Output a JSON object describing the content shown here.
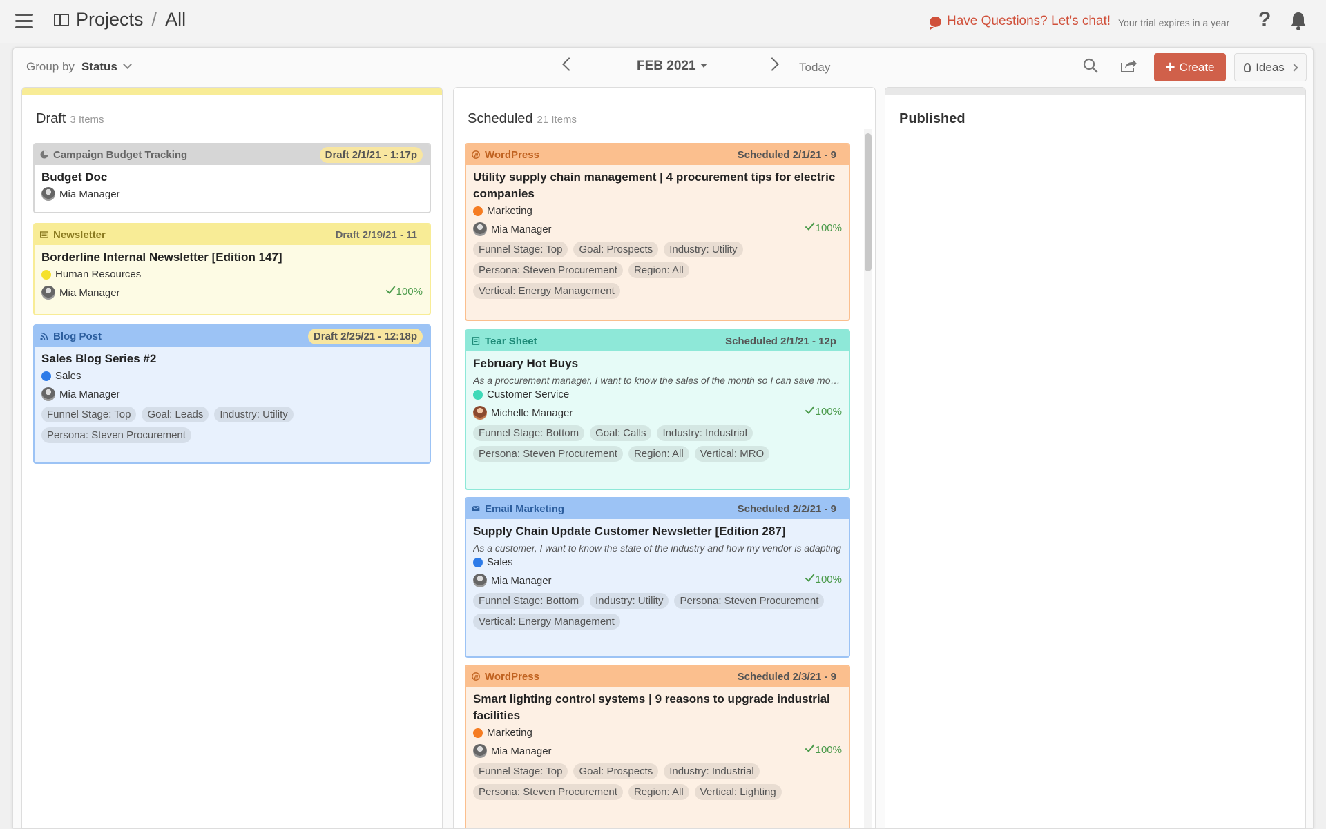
{
  "topbar": {
    "breadcrumb_root": "Projects",
    "breadcrumb_sep": "/",
    "breadcrumb_current": "All",
    "chat_label": "Have Questions? Let's chat!",
    "trial_text": "Your trial expires in a year",
    "help_label": "?"
  },
  "toolbar": {
    "group_by_label": "Group by",
    "group_by_value": "Status",
    "month": "FEB 2021",
    "today_label": "Today",
    "create_label": "Create",
    "ideas_label": "Ideas"
  },
  "columns": {
    "draft": {
      "title": "Draft",
      "count": "3 Items",
      "color": "#f8ec96"
    },
    "scheduled": {
      "title": "Scheduled",
      "count": "21 Items",
      "color": "#ffffff"
    },
    "published": {
      "title": "Published",
      "color": "#e8e8e8"
    }
  },
  "draft_cards": [
    {
      "type": "Campaign Budget Tracking",
      "date": "Draft 2/1/21 - 1:17p",
      "title": "Budget Doc",
      "owner": "Mia Manager"
    },
    {
      "type": "Newsletter",
      "date": "Draft 2/19/21 - 11",
      "title": "Borderline Internal Newsletter [Edition 147]",
      "dept": "Human Resources",
      "dept_color": "#f5e12a",
      "owner": "Mia Manager",
      "pct": "100%"
    },
    {
      "type": "Blog Post",
      "date": "Draft 2/25/21 - 12:18p",
      "title": "Sales Blog Series #2",
      "dept": "Sales",
      "dept_color": "#2d7be8",
      "owner": "Mia Manager",
      "tags": [
        "Funnel Stage: Top",
        "Goal: Leads",
        "Industry: Utility",
        "Persona: Steven Procurement"
      ]
    }
  ],
  "scheduled_cards": [
    {
      "type": "WordPress",
      "date": "Scheduled 2/1/21 - 9",
      "title": "Utility supply chain management | 4 procurement tips for electric companies",
      "dept": "Marketing",
      "dept_color": "#f57c22",
      "owner": "Mia Manager",
      "pct": "100%",
      "tags": [
        "Funnel Stage: Top",
        "Goal: Prospects",
        "Industry: Utility",
        "Persona: Steven Procurement",
        "Region: All",
        "Vertical: Energy Management"
      ]
    },
    {
      "type": "Tear Sheet",
      "date": "Scheduled 2/1/21 - 12p",
      "title": "February Hot Buys",
      "desc": "As a procurement manager, I want to know the sales of the month so I can save money",
      "dept": "Customer Service",
      "dept_color": "#3fd9b8",
      "owner": "Michelle Manager",
      "pct": "100%",
      "tags": [
        "Funnel Stage: Bottom",
        "Goal: Calls",
        "Industry: Industrial",
        "Persona: Steven Procurement",
        "Region: All",
        "Vertical: MRO"
      ]
    },
    {
      "type": "Email Marketing",
      "date": "Scheduled 2/2/21 - 9",
      "title": "Supply Chain Update Customer Newsletter [Edition 287]",
      "desc": "As a customer, I want to know the state of the industry and how my vendor is adapting",
      "dept": "Sales",
      "dept_color": "#2d7be8",
      "owner": "Mia Manager",
      "pct": "100%",
      "tags": [
        "Funnel Stage: Bottom",
        "Industry: Utility",
        "Persona: Steven Procurement",
        "Vertical: Energy Management"
      ]
    },
    {
      "type": "WordPress",
      "date": "Scheduled 2/3/21 - 9",
      "title": "Smart lighting control systems | 9 reasons to upgrade industrial facilities",
      "dept": "Marketing",
      "dept_color": "#f57c22",
      "owner": "Mia Manager",
      "pct": "100%",
      "tags": [
        "Funnel Stage: Top",
        "Goal: Prospects",
        "Industry: Industrial",
        "Persona: Steven Procurement",
        "Region: All",
        "Vertical: Lighting"
      ]
    }
  ]
}
